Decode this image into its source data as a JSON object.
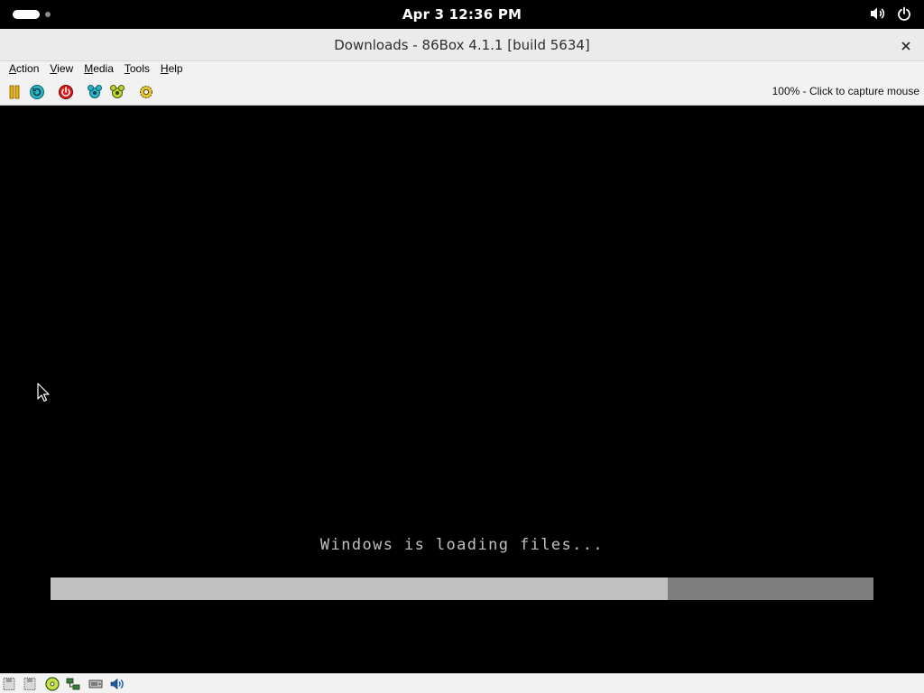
{
  "topbar": {
    "clock": "Apr 3  12:36 PM"
  },
  "window": {
    "title": "Downloads - 86Box 4.1.1 [build 5634]"
  },
  "menu": {
    "items": [
      "Action",
      "View",
      "Media",
      "Tools",
      "Help"
    ]
  },
  "toolbar": {
    "icons": [
      "pause-icon",
      "reset-icon",
      "power-icon",
      "ctrl-alt-del-icon",
      "ctrl-alt-esc-icon",
      "settings-icon"
    ],
    "status_message": "100% - Click to capture mouse"
  },
  "screen": {
    "loading_text": "Windows is loading files...",
    "progress_fraction": 0.75
  },
  "statusbar": {
    "icons": [
      "floppy-a-icon",
      "floppy-b-icon",
      "cdrom-icon",
      "network-icon",
      "hard-disk-icon",
      "sound-icon"
    ]
  },
  "colors": {
    "progress_fill": "#c0c0c0",
    "progress_track": "#7f7f7f",
    "screen_text": "#c0c0c0",
    "chrome_bg": "#f2f2f2"
  }
}
